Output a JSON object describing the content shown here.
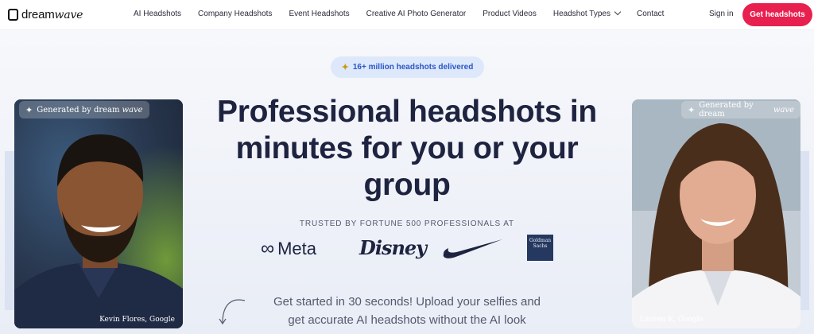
{
  "brand": {
    "name_part1": "dream",
    "name_part2": "wave"
  },
  "nav": {
    "links": [
      {
        "label": "AI Headshots"
      },
      {
        "label": "Company Headshots"
      },
      {
        "label": "Event Headshots"
      },
      {
        "label": "Creative AI Photo Generator"
      },
      {
        "label": "Product Videos"
      },
      {
        "label": "Headshot Types"
      },
      {
        "label": "Contact"
      }
    ],
    "signin": "Sign in",
    "cta": "Get headshots"
  },
  "hero": {
    "badge": "16+ million headshots delivered",
    "headline": "Professional headshots in minutes for you or your group",
    "trusted": "TRUSTED BY FORTUNE 500 PROFESSIONALS AT",
    "logos": {
      "meta": "Meta",
      "disney": "Disney",
      "goldman": "Goldman Sachs"
    },
    "subtext_line1": "Get started in 30 seconds! Upload your selfies and",
    "subtext_line2": "get accurate AI headshots without the AI look"
  },
  "cards": {
    "left": {
      "tag_prefix": "Generated by dream",
      "tag_suffix": "wave",
      "caption": "Kevin Flores, Google"
    },
    "right": {
      "tag_prefix": "Generated by dream",
      "tag_suffix": "wave",
      "caption": "Lauren K, Google"
    }
  },
  "colors": {
    "accent": "#e8204f",
    "badge_bg": "#dde8fb",
    "badge_text": "#2b56c7",
    "headline": "#1e2340"
  }
}
